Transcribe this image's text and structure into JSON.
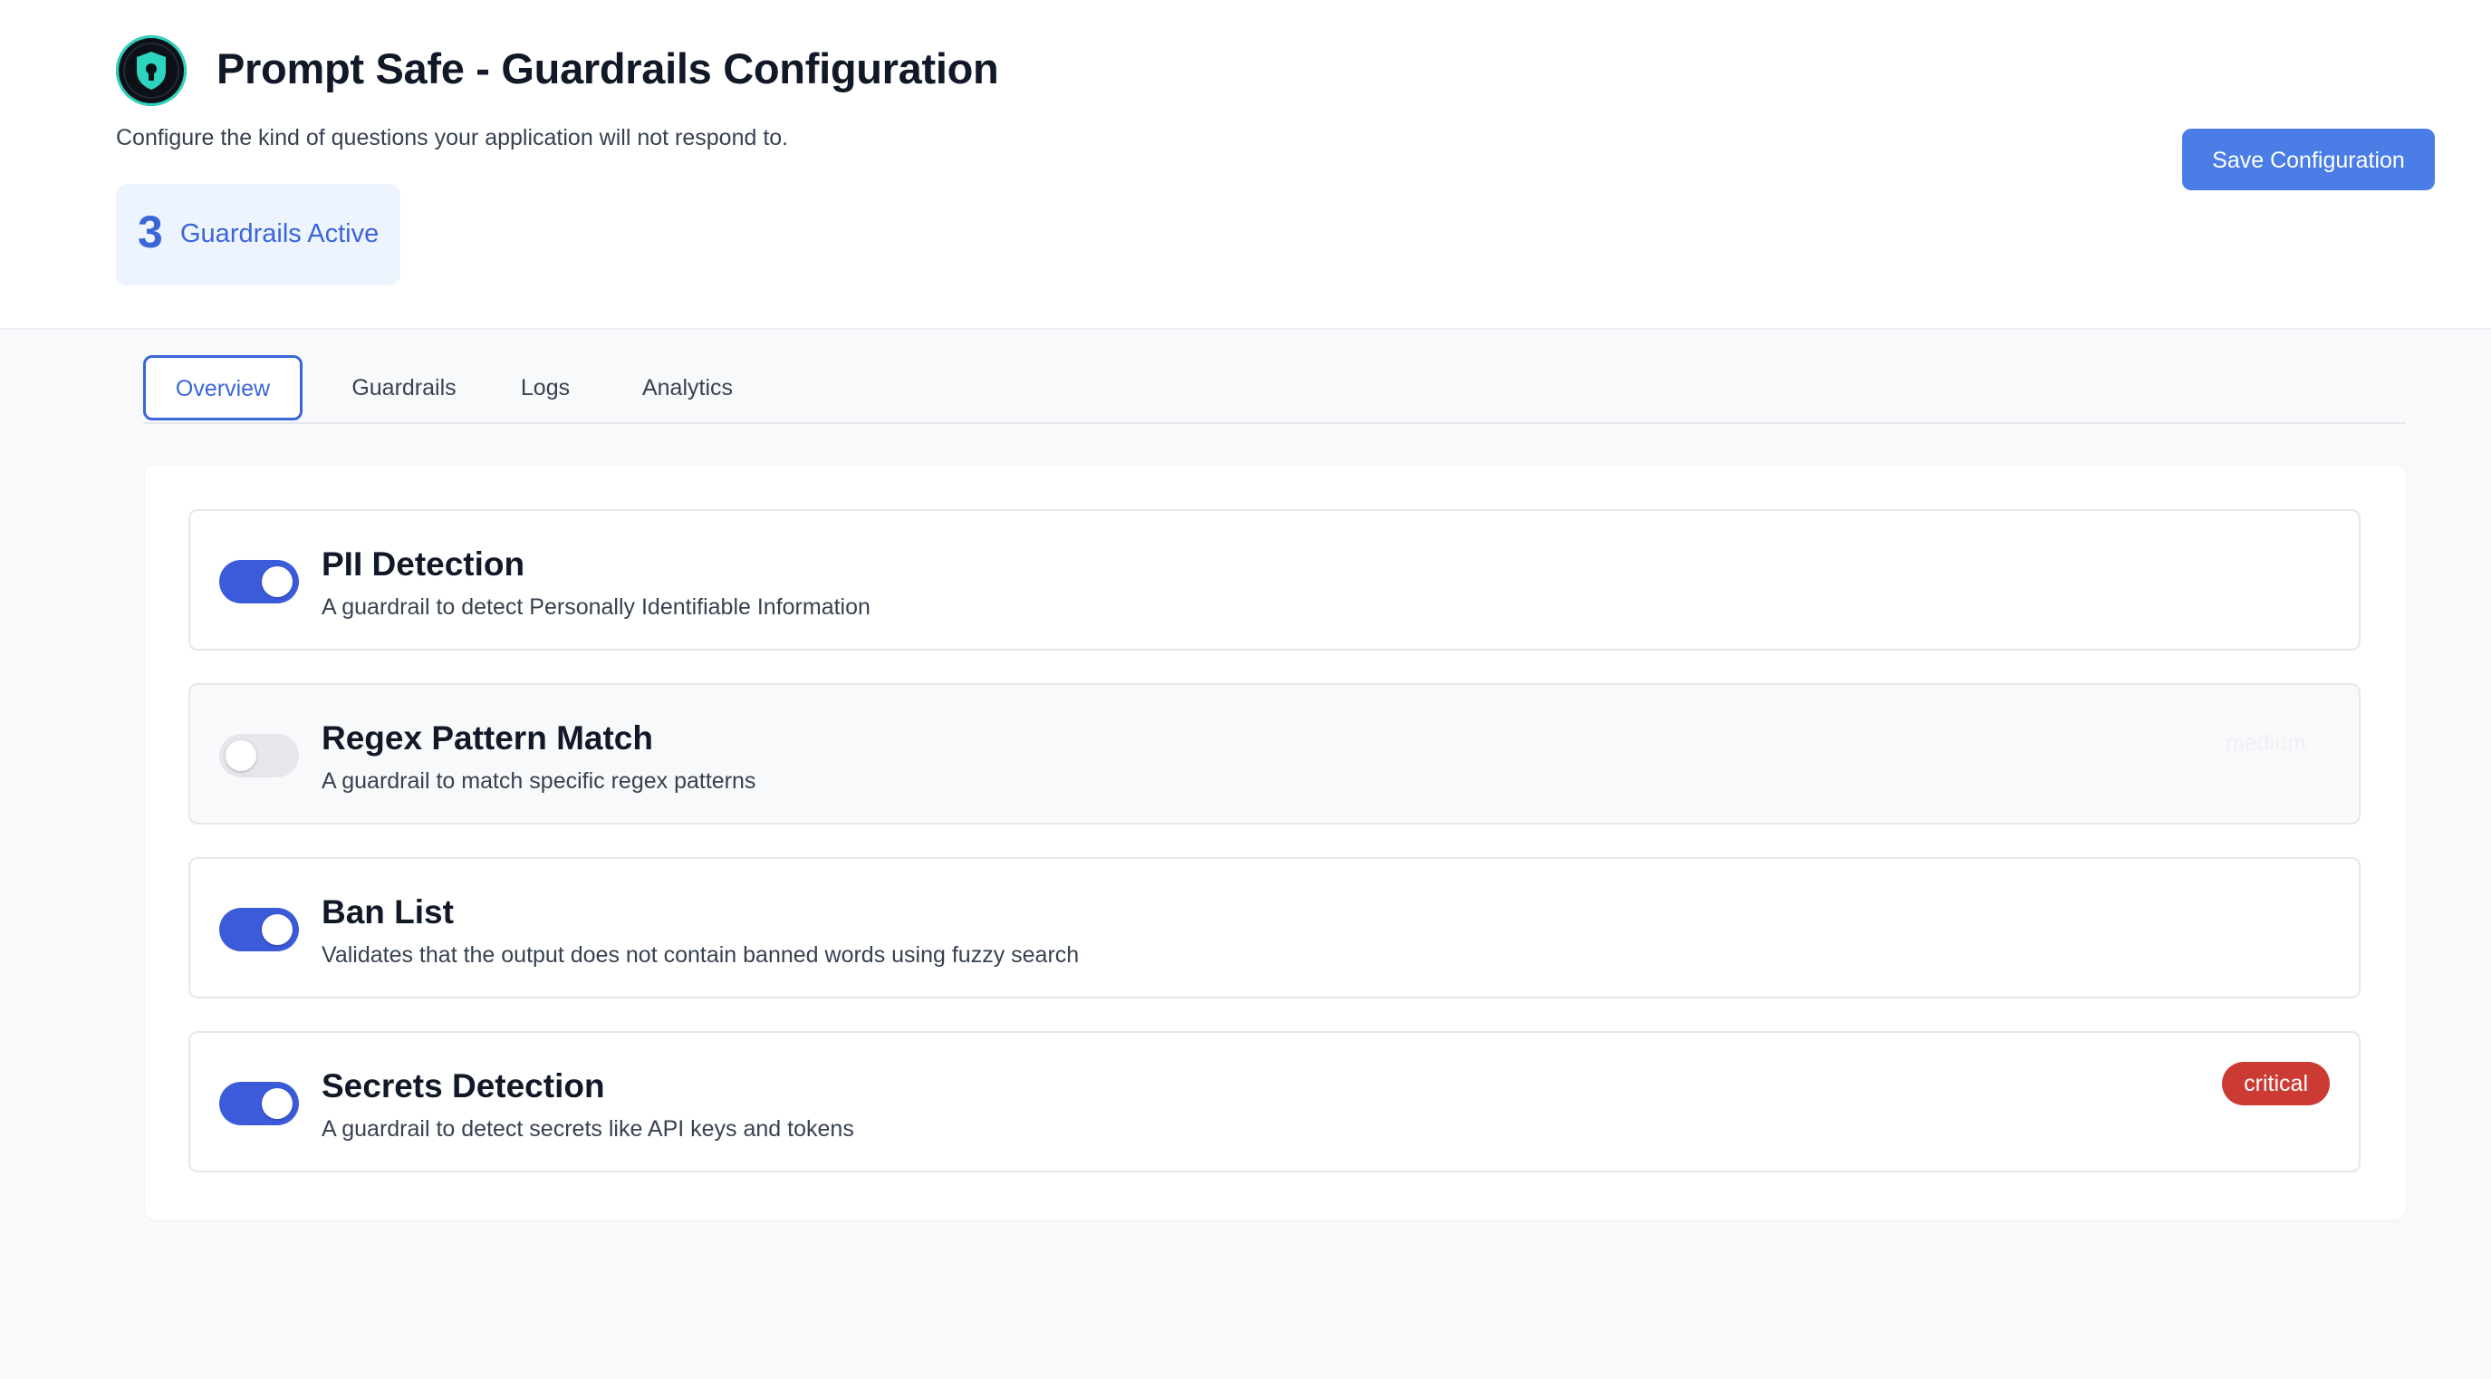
{
  "header": {
    "title": "Prompt Safe - Guardrails Configuration",
    "subtitle": "Configure the kind of questions your application will not respond to.",
    "active_count": "3",
    "active_label": "Guardrails Active",
    "save_label": "Save Configuration"
  },
  "tabs": [
    {
      "label": "Overview",
      "active": true
    },
    {
      "label": "Guardrails",
      "active": false
    },
    {
      "label": "Logs",
      "active": false
    },
    {
      "label": "Analytics",
      "active": false
    }
  ],
  "guardrails": [
    {
      "title": "PII Detection",
      "description": "A guardrail to detect Personally Identifiable Information",
      "enabled": true,
      "severity": ""
    },
    {
      "title": "Regex Pattern Match",
      "description": "A guardrail to match specific regex patterns",
      "enabled": false,
      "severity": "medium"
    },
    {
      "title": "Ban List",
      "description": "Validates that the output does not contain banned words using fuzzy search",
      "enabled": true,
      "severity": ""
    },
    {
      "title": "Secrets Detection",
      "description": "A guardrail to detect secrets like API keys and tokens",
      "enabled": true,
      "severity": "critical"
    }
  ],
  "colors": {
    "accent": "#3b66d8",
    "toggle_on": "#3b5bdb",
    "save_button": "#4a7ee6",
    "critical_badge": "#cc3b33"
  }
}
